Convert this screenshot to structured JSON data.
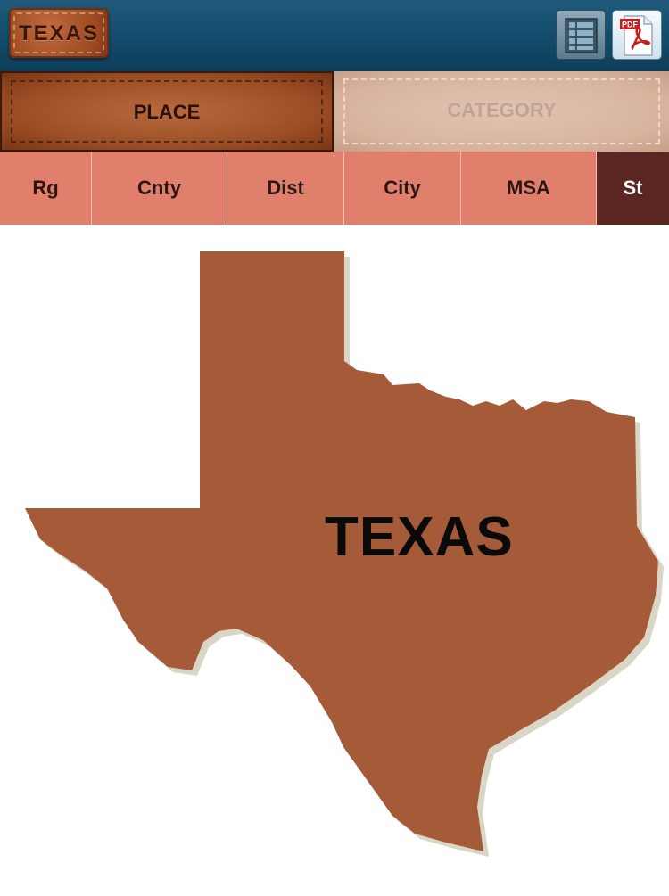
{
  "header": {
    "logo_label": "TEXAS",
    "list_icon": "table-list-icon",
    "pdf_icon": "pdf-document-icon",
    "pdf_badge": "PDF"
  },
  "main_tabs": [
    {
      "label": "PLACE",
      "selected": true
    },
    {
      "label": "CATEGORY",
      "selected": false
    }
  ],
  "sub_tabs": [
    {
      "label": "Rg",
      "selected": false
    },
    {
      "label": "Cnty",
      "selected": false
    },
    {
      "label": "Dist",
      "selected": false
    },
    {
      "label": "City",
      "selected": false
    },
    {
      "label": "MSA",
      "selected": false
    },
    {
      "label": "St",
      "selected": true
    }
  ],
  "map": {
    "state_label": "TEXAS",
    "fill_color": "#a55a38"
  },
  "colors": {
    "header": "#124a69",
    "subnav": "#e07f6c",
    "subnav_active": "#5a2621"
  }
}
